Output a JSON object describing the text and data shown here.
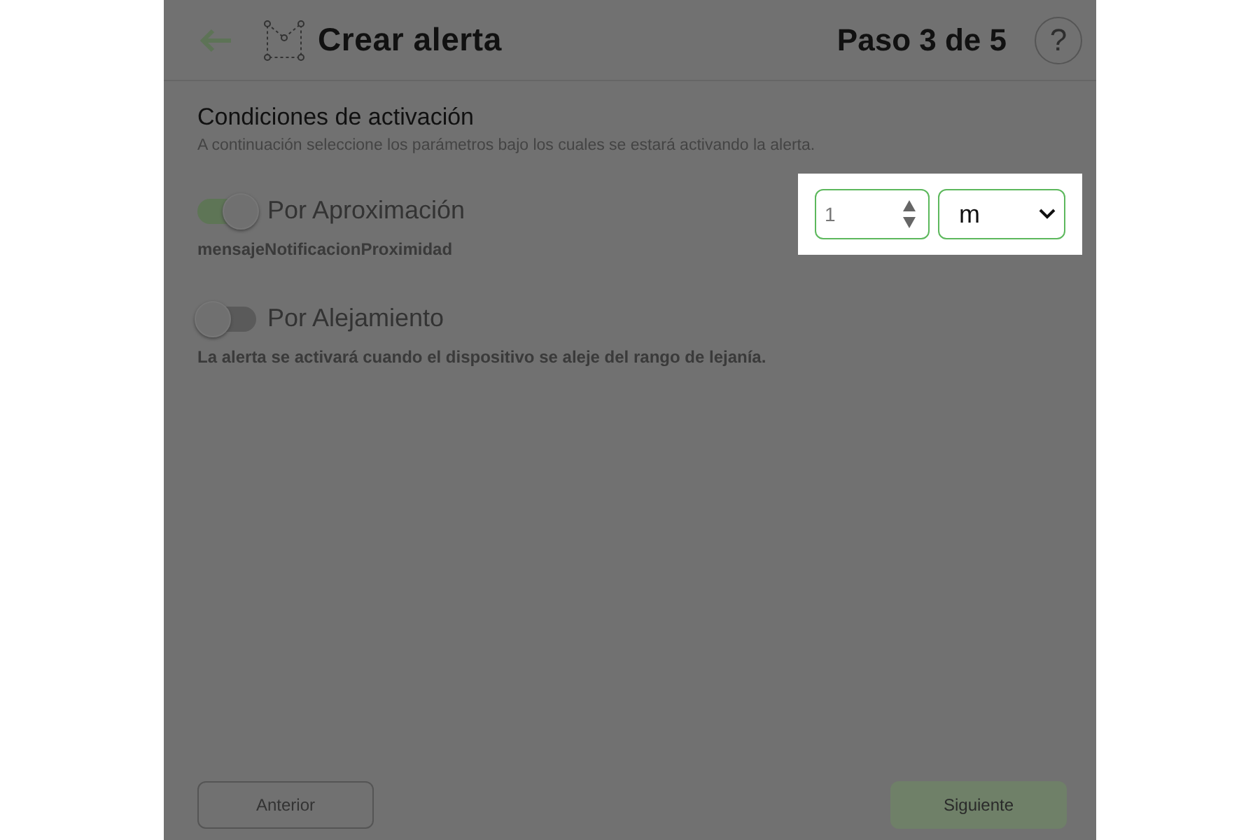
{
  "header": {
    "title": "Crear alerta",
    "step": "Paso 3 de 5",
    "help": "?"
  },
  "section": {
    "title": "Condiciones de activación",
    "subtitle": "A continuación seleccione los parámetros bajo los cuales se estará activando la alerta."
  },
  "conditions": [
    {
      "label": "Por Aproximación",
      "on": true,
      "note": "mensajeNotificacionProximidad"
    },
    {
      "label": "Por Alejamiento",
      "on": false,
      "note": "La alerta se activará cuando el dispositivo se aleje del rango de lejanía."
    }
  ],
  "distance": {
    "value": "1",
    "unit": "m"
  },
  "buttons": [
    {
      "label": "Anterior",
      "kind": "secondary"
    },
    {
      "label": "Siguiente",
      "kind": "primary"
    }
  ]
}
